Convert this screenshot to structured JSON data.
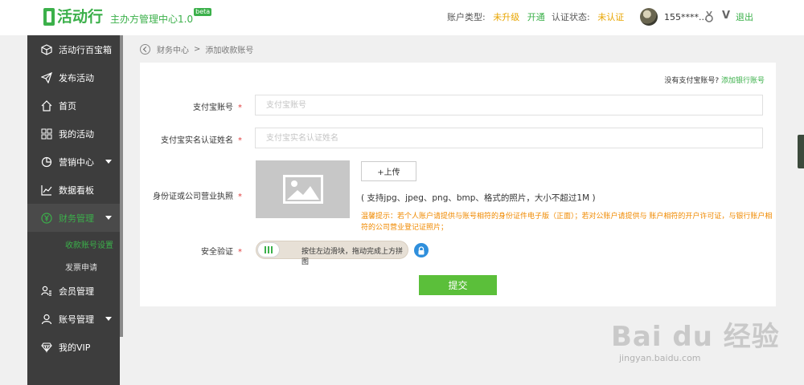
{
  "header": {
    "logo_text": "活动行",
    "logo_sub": "主办方管理中心1.0",
    "beta": "beta",
    "account_type_label": "账户类型:",
    "account_type_value": "未升级",
    "account_open_link": "开通",
    "auth_status_label": "认证状态:",
    "auth_status_value": "未认证",
    "username": "155****...",
    "vip_mark": "V",
    "logout": "退出"
  },
  "sidebar": {
    "items": [
      {
        "label": "活动行百宝箱",
        "icon": "cube-icon"
      },
      {
        "label": "发布活动",
        "icon": "send-icon"
      },
      {
        "label": "首页",
        "icon": "home-icon"
      },
      {
        "label": "我的活动",
        "icon": "grid-icon"
      },
      {
        "label": "营销中心",
        "icon": "pie-icon"
      },
      {
        "label": "数据看板",
        "icon": "chart-icon"
      },
      {
        "label": "财务管理",
        "icon": "yen-icon"
      },
      {
        "label": "会员管理",
        "icon": "members-icon"
      },
      {
        "label": "账号管理",
        "icon": "user-icon"
      },
      {
        "label": "我的VIP",
        "icon": "diamond-icon"
      }
    ],
    "sub_items": [
      "收款账号设置",
      "发票申请"
    ]
  },
  "breadcrumb": {
    "parent": "财务中心",
    "sep": ">",
    "current": "添加收款账号"
  },
  "form": {
    "no_alipay_text": "没有支付宝账号?",
    "add_bank_link": "添加银行账号",
    "alipay_label": "支付宝账号",
    "alipay_placeholder": "支付宝账号",
    "name_label": "支付宝实名认证姓名",
    "name_placeholder": "支付宝实名认证姓名",
    "id_label": "身份证或公司营业执照",
    "upload_label": "+上传",
    "support_text": "( 支持jpg、jpeg、png、bmp、格式的照片，大小不超过1M )",
    "tip_text": "温馨提示：若个人账户请提供与账号相符的身份证件电子版（正面）；若对公账户请提供与 账户相符的开户许可证，与银行账户相符的公司营业登记证照片；",
    "verify_label": "安全验证",
    "slider_text": "按住左边滑块，拖动完成上方拼图",
    "required_mark": "*",
    "submit_label": "提交"
  },
  "watermark": {
    "text": "Bai du 经验",
    "url": "jingyan.baidu.com"
  },
  "colors": {
    "brand_green": "#3bb04a",
    "warning_orange": "#f08a00",
    "status_yellow": "#e8a500",
    "sidebar_bg": "#3d3d3d"
  }
}
